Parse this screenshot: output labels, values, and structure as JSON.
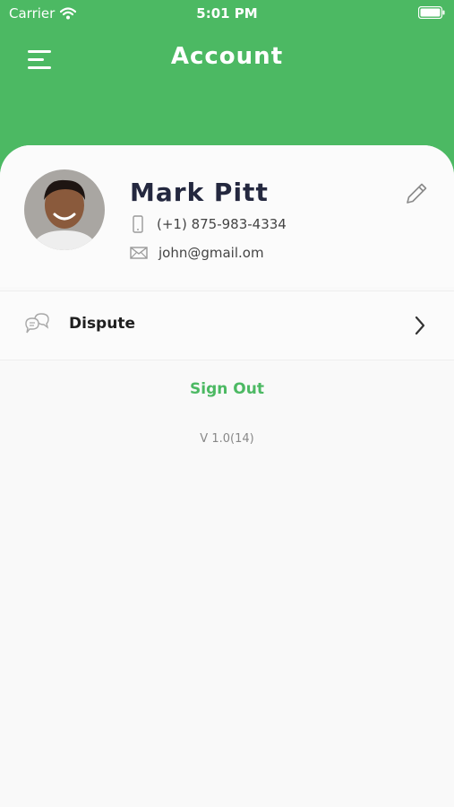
{
  "status_bar": {
    "carrier": "Carrier",
    "time": "5:01 PM"
  },
  "header": {
    "title": "Account",
    "background_color": "#4cb963"
  },
  "profile": {
    "name": "Mark Pitt",
    "phone": "(+1) 875-983-4334",
    "email": "john@gmail.om",
    "icons": [
      "phone-icon",
      "mail-icon",
      "edit-pencil-icon"
    ]
  },
  "menu": {
    "items": [
      {
        "label": "Dispute",
        "icon": "chat-bubbles-icon"
      }
    ]
  },
  "sign_out_label": "Sign Out",
  "version": "V 1.0(14)",
  "colors": {
    "accent": "#4cb963",
    "name_text": "#24283f",
    "background": "#f9f9f9"
  }
}
